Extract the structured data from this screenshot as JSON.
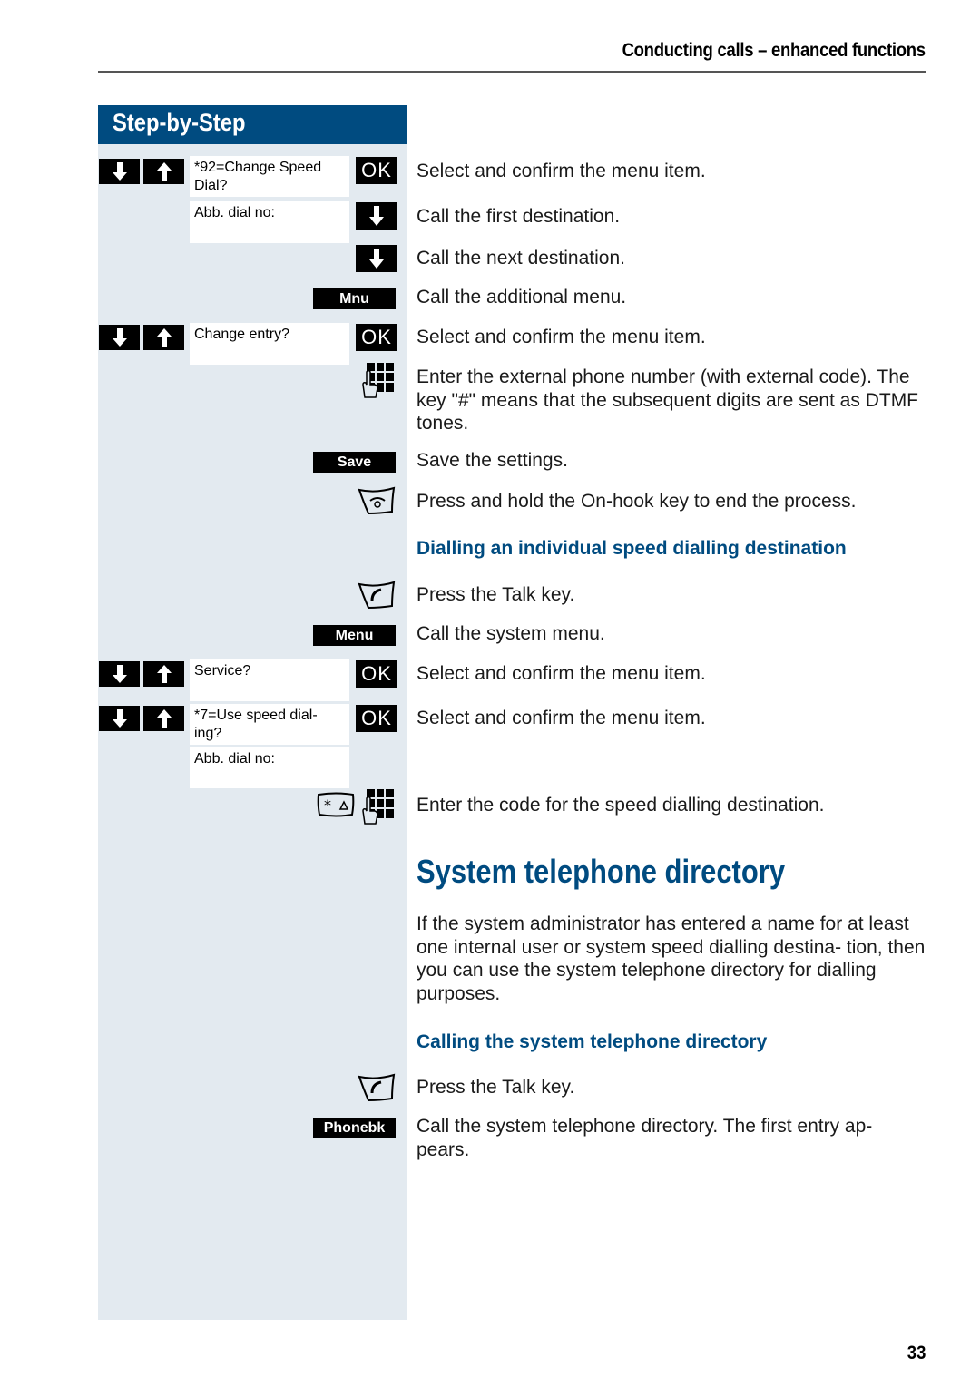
{
  "header": {
    "section_title": "Conducting calls – enhanced functions"
  },
  "sidebar": {
    "title": "Step-by-Step"
  },
  "displays": {
    "d1": "*92=Change Speed Dial?",
    "d2": "Abb. dial no:",
    "d3": "Change entry?",
    "d4": "Service?",
    "d5": "*7=Use speed dial- ing?",
    "d6": "Abb. dial no:"
  },
  "keys": {
    "ok": "OK",
    "mnu": "Mnu",
    "save": "Save",
    "menu": "Menu",
    "phonebk": "Phonebk"
  },
  "steps": {
    "s1": "Select and confirm the menu item.",
    "s2": "Call the first destination.",
    "s3": "Call the next destination.",
    "s4": "Call the additional menu.",
    "s5": "Select and confirm the menu item.",
    "s6": "Enter the external phone number (with external code). The key \"#\" means that the subsequent digits are sent as DTMF tones.",
    "s7": "Save the settings.",
    "s8": "Press and hold the On-hook key to end the process.",
    "s9": "Press the Talk key.",
    "s10": "Call the system menu.",
    "s11": "Select and confirm the menu item.",
    "s12": "Select and confirm the menu item.",
    "s13": "Enter the code for the speed dialling destination.",
    "s14": "Press the Talk key.",
    "s15": "Call the system telephone directory. The first entry ap- pears."
  },
  "subheadings": {
    "h1": "Dialling an individual speed dialling destination",
    "h2": "Calling the system telephone directory"
  },
  "section": {
    "title": "System telephone directory",
    "intro": "If the system administrator has entered a name for at least one internal user or system speed dialling destina- tion, then you can use the system telephone directory for dialling purposes."
  },
  "footer": {
    "page_number": "33"
  },
  "colors": {
    "accent": "#004b80",
    "sidebar_bg": "#e3eaf0"
  }
}
